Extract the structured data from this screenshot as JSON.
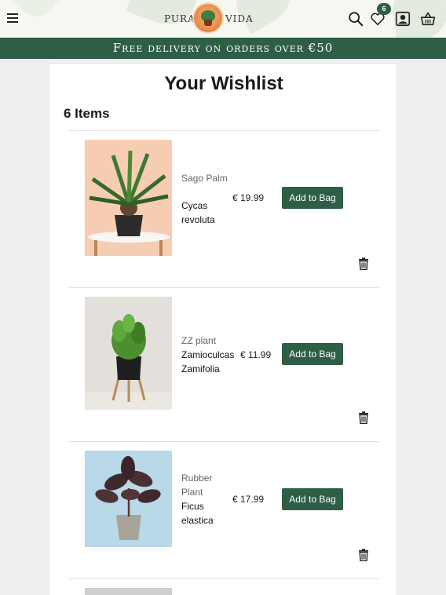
{
  "header": {
    "brand_left": "PURA",
    "brand_right": "VIDA",
    "wishlist_count": "6",
    "icons": [
      "menu-icon",
      "search-icon",
      "heart-icon",
      "user-icon",
      "basket-icon"
    ]
  },
  "banner": {
    "text": "Free delivery on orders over €50"
  },
  "wishlist": {
    "title": "Your Wishlist",
    "count_label": "6 Items",
    "items": [
      {
        "name": "Sago Palm",
        "latin": "Cycas revoluta",
        "price": "€ 19.99",
        "button": "Add to Bag"
      },
      {
        "name": "ZZ plant",
        "latin": "Zamioculcas Zamifolia",
        "price": "€ 11.99",
        "button": "Add to Bag"
      },
      {
        "name": "Rubber Plant",
        "latin": "Ficus elastica",
        "price": "€ 17.99",
        "button": "Add to Bag"
      }
    ]
  },
  "colors": {
    "brand_green": "#2e5e46",
    "page_bg": "#efefef"
  }
}
